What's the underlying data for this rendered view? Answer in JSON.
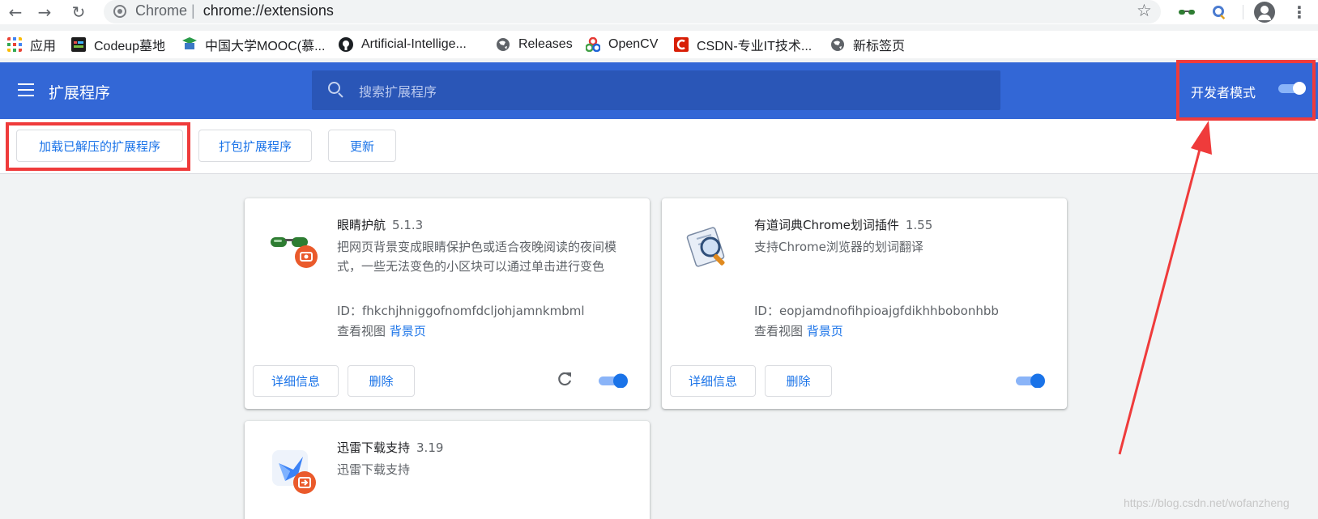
{
  "browser": {
    "omnibox_prefix": "Chrome",
    "omnibox_separator": "|",
    "url": "chrome://extensions"
  },
  "bookmarks": [
    {
      "label": "应用",
      "icon": "apps-grid-icon"
    },
    {
      "label": "Codeup墓地",
      "icon": "codeup-icon"
    },
    {
      "label": "中国大学MOOC(慕...",
      "icon": "mooc-icon"
    },
    {
      "label": "Artificial-Intellige...",
      "icon": "github-icon"
    },
    {
      "label": "Releases",
      "icon": "globe-icon"
    },
    {
      "label": "OpenCV",
      "icon": "opencv-icon"
    },
    {
      "label": "CSDN-专业IT技术...",
      "icon": "csdn-icon"
    },
    {
      "label": "新标签页",
      "icon": "globe-icon"
    }
  ],
  "header": {
    "title": "扩展程序",
    "search_placeholder": "搜索扩展程序",
    "dev_mode_label": "开发者模式",
    "dev_mode_on": true
  },
  "dev_toolbar": {
    "load_unpacked": "加载已解压的扩展程序",
    "pack": "打包扩展程序",
    "update": "更新"
  },
  "extensions": [
    {
      "name": "眼睛护航",
      "version": "5.1.3",
      "description": "把网页背景变成眼睛保护色或适合夜晚阅读的夜间模式，一些无法变色的小区块可以通过单击进行变色",
      "id_label": "ID：",
      "id": "fhkchjhniggofnomfdcljohjamnkmbml",
      "views_label": "查看视图",
      "views_link": "背景页",
      "details": "详细信息",
      "remove": "删除",
      "enabled": true
    },
    {
      "name": "有道词典Chrome划词插件",
      "version": "1.55",
      "description": "支持Chrome浏览器的划词翻译",
      "id_label": "ID：",
      "id": "eopjamdnofihpioajgfdikhhbobonhbb",
      "views_label": "查看视图",
      "views_link": "背景页",
      "details": "详细信息",
      "remove": "删除",
      "enabled": true
    },
    {
      "name": "迅雷下载支持",
      "version": "3.19",
      "description": "迅雷下载支持"
    }
  ],
  "watermark": "https://blog.csdn.net/wofanzheng",
  "colors": {
    "header_blue": "#3367d6",
    "link_blue": "#1a73e8",
    "annotation_red": "#ef3b3b"
  }
}
